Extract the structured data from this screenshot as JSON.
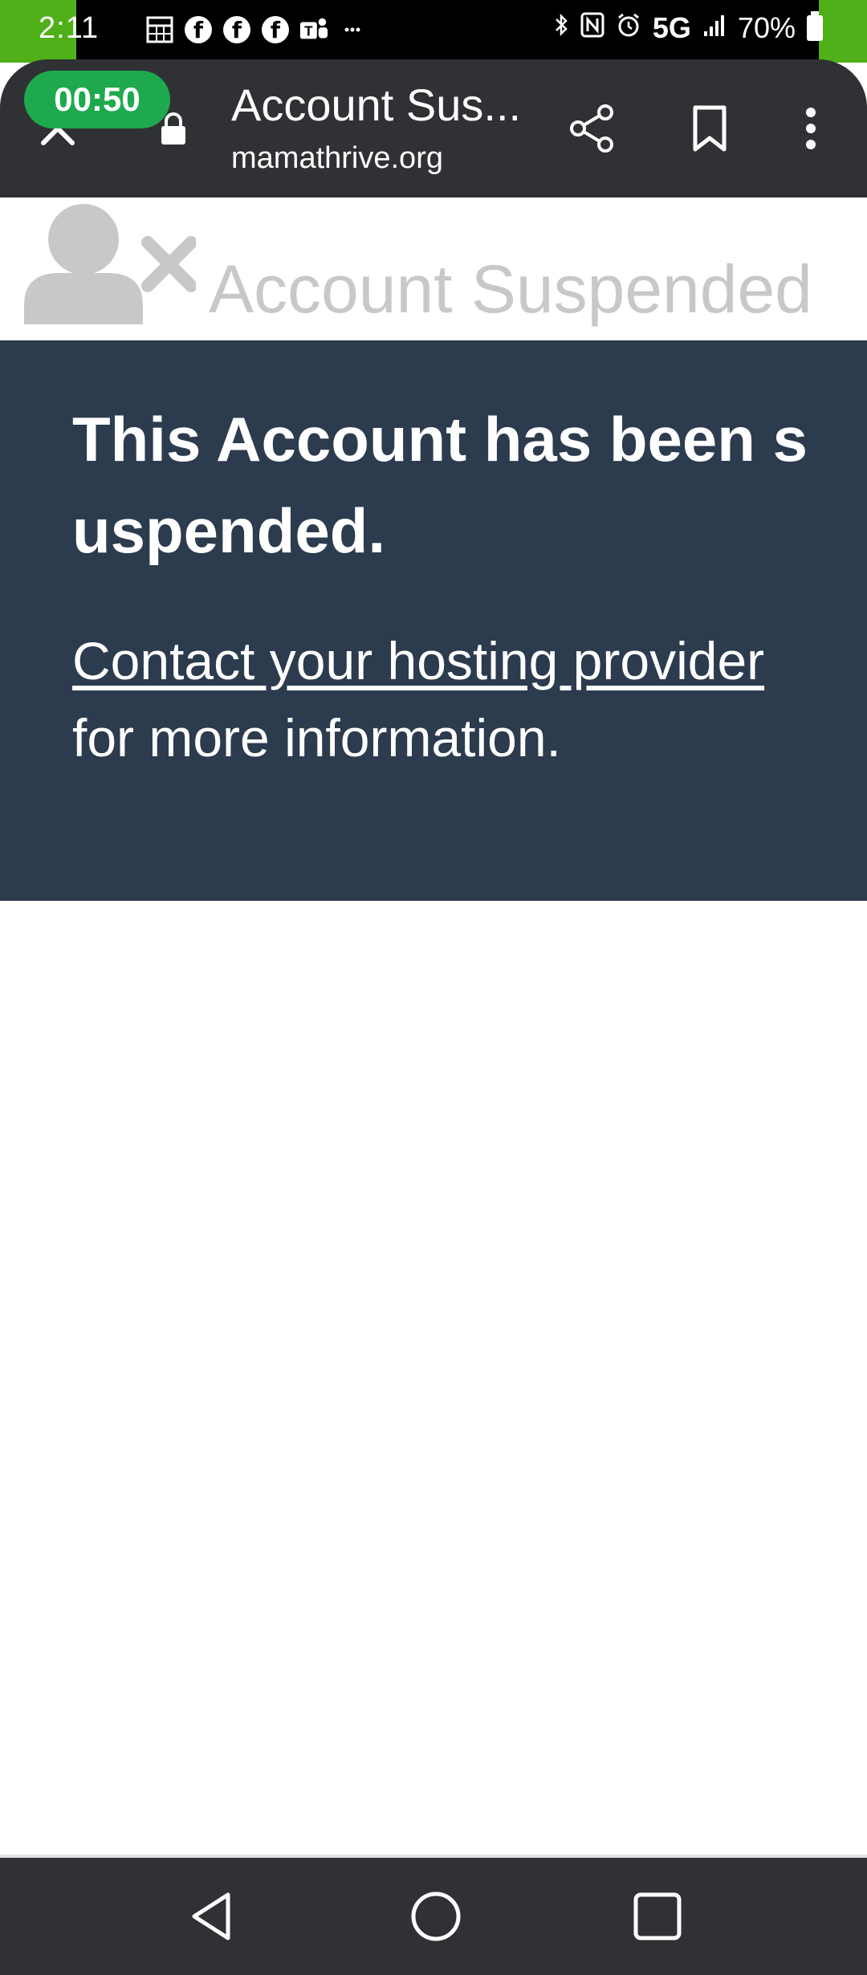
{
  "status_bar": {
    "time": "2:11",
    "network": "5G",
    "battery": "70%",
    "left_icons": [
      "sheets-icon",
      "facebook-icon",
      "facebook-icon",
      "facebook-icon",
      "teams-icon",
      "more-notifications-icon"
    ],
    "right_icons": [
      "bluetooth-icon",
      "nfc-icon",
      "alarm-icon",
      "signal-icon",
      "battery-icon"
    ],
    "accent_color": "#4fb019"
  },
  "browser": {
    "timer": "00:50",
    "page_title": "Account Sus...",
    "url": "mamathrive.org",
    "toolbar_color": "#303134",
    "timer_color": "#1ea94e"
  },
  "page": {
    "header_title": "Account Suspended",
    "heading": "This Account has been suspended.",
    "link_text": "Contact your hosting provider",
    "after_link_text": " for more information.",
    "panel_color": "#2c3b4d"
  },
  "nav": {
    "buttons": [
      "back-icon",
      "home-icon",
      "recent-apps-icon"
    ]
  }
}
